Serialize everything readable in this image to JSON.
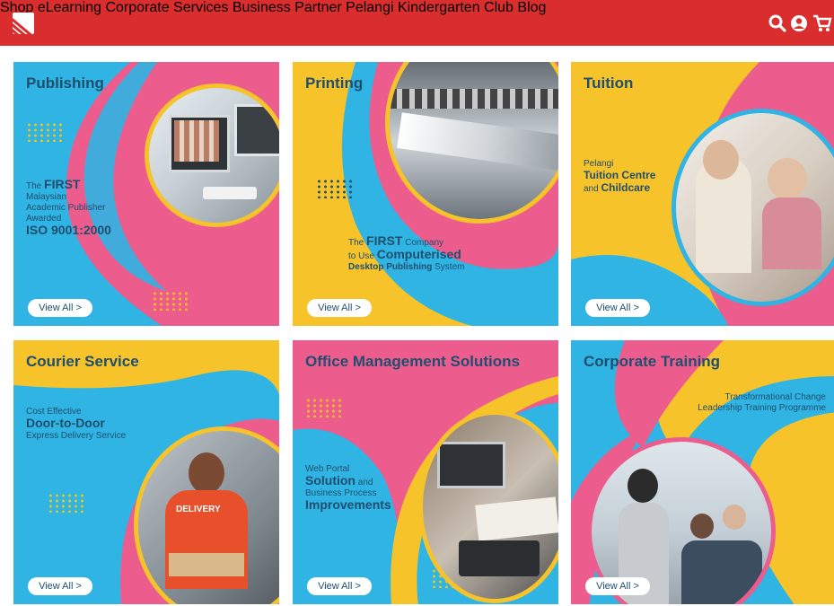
{
  "nav": {
    "items": [
      {
        "label": "Shop"
      },
      {
        "label": "eLearning"
      },
      {
        "label": "Corporate Services"
      },
      {
        "label": "Business Partner"
      },
      {
        "label": "Pelangi Kindergarten Club"
      },
      {
        "label": "Blog"
      }
    ],
    "icons": [
      "search-icon",
      "account-icon",
      "cart-icon"
    ]
  },
  "colors": {
    "header": "#d92d2e",
    "pink": "#ec5d8e",
    "blue": "#2fb4e4",
    "yellow": "#f6c32a",
    "navy": "#1f4e6e"
  },
  "cards": [
    {
      "title": "Publishing",
      "caption_lines": [
        "The",
        "FIRST",
        "Malaysian",
        "Academic Publisher",
        "Awarded",
        "ISO 9001:2000"
      ],
      "view_all": "View All >"
    },
    {
      "title": "Printing",
      "caption_lines": [
        "The",
        "FIRST",
        "Company",
        "to Use",
        "Computerised",
        "Desktop Publishing",
        "System"
      ],
      "view_all": "View All >"
    },
    {
      "title": "Tuition",
      "caption_lines": [
        "Pelangi",
        "Tuition Centre",
        "and",
        "Childcare"
      ],
      "view_all": "View All >"
    },
    {
      "title": "Courier Service",
      "caption_lines": [
        "Cost Effective",
        "Door-to-Door",
        "Express Delivery Service"
      ],
      "view_all": "View All >",
      "shirt_text": "DELIVERY"
    },
    {
      "title": "Office Management Solutions",
      "caption_lines": [
        "Web Portal",
        "Solution",
        "and",
        "Business Process",
        "Improvements"
      ],
      "view_all": "View All >"
    },
    {
      "title": "Corporate Training",
      "caption_lines": [
        "Transformational Change",
        "Leadership Training Programme"
      ],
      "view_all": "View All >"
    }
  ]
}
